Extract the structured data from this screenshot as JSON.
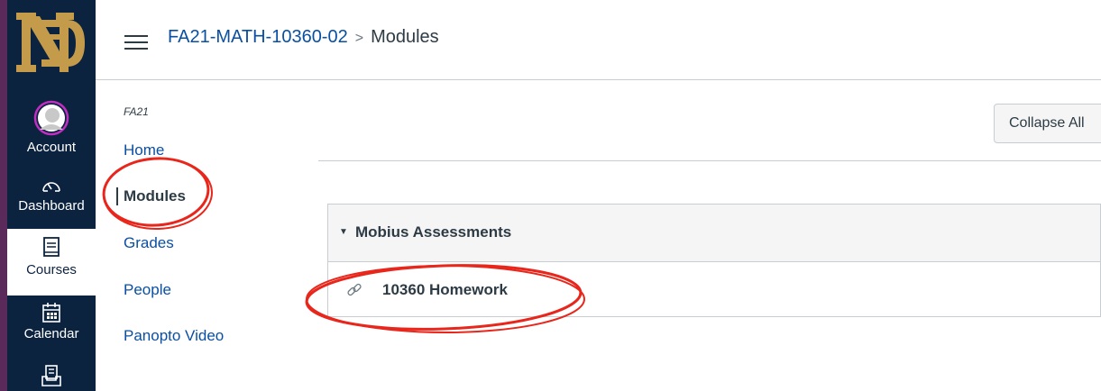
{
  "global_nav": {
    "items": [
      {
        "label": "Account",
        "icon": "account-avatar"
      },
      {
        "label": "Dashboard",
        "icon": "dashboard-icon"
      },
      {
        "label": "Courses",
        "icon": "courses-icon",
        "active": true
      },
      {
        "label": "Calendar",
        "icon": "calendar-icon"
      },
      {
        "label": "",
        "icon": "inbox-icon"
      }
    ],
    "colors": {
      "background": "#0c2340",
      "accent": "#5a2a5a",
      "active_text": "#0c2340"
    }
  },
  "breadcrumb": {
    "course": "FA21-MATH-10360-02",
    "separator": ">",
    "page": "Modules"
  },
  "course_nav": {
    "term": "FA21",
    "items": [
      {
        "label": "Home"
      },
      {
        "label": "Modules",
        "active": true
      },
      {
        "label": "Grades"
      },
      {
        "label": "People"
      },
      {
        "label": "Panopto Video"
      }
    ]
  },
  "toolbar": {
    "collapse_all_label": "Collapse All"
  },
  "modules": [
    {
      "name": "Mobius Assessments",
      "items": [
        {
          "title": "10360 Homework",
          "icon": "link-icon"
        }
      ]
    }
  ],
  "annotation_color": "#e8261b"
}
